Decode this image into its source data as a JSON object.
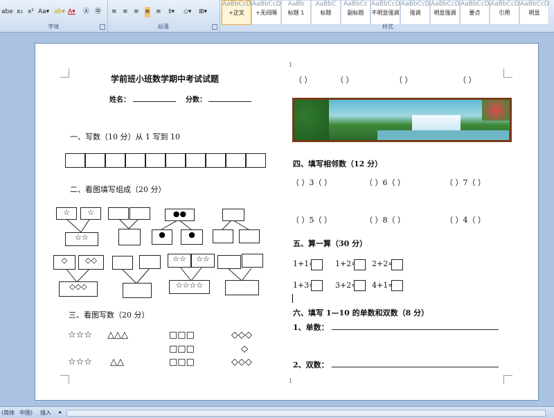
{
  "ribbon": {
    "font_group_label": "字体",
    "paragraph_group_label": "段落",
    "styles_group_label": "样式",
    "styles": [
      {
        "name": "+正文",
        "sample": "AaBbCcDd"
      },
      {
        "name": "+无间隔",
        "sample": "AaBbCcDd"
      },
      {
        "name": "标题 1",
        "sample": "AaBb"
      },
      {
        "name": "标题",
        "sample": "AaBbC"
      },
      {
        "name": "副标题",
        "sample": "AaBbCc"
      },
      {
        "name": "不明显强调",
        "sample": "AaBbCcDd"
      },
      {
        "name": "强调",
        "sample": "AaBbCcDd"
      },
      {
        "name": "明显强调",
        "sample": "AaBbCcDd"
      },
      {
        "name": "要点",
        "sample": "AaBbCcDd"
      },
      {
        "name": "引用",
        "sample": "AaBbCcDd"
      },
      {
        "name": "明显",
        "sample": "AaBbCcDd"
      }
    ]
  },
  "doc": {
    "title": "学前班小班数学期中考试试题",
    "name_label": "姓名：",
    "score_label": "分数：",
    "q1": "一、写数（10 分）从 1 写到 10",
    "q2": "二、看图填写组成（20 分）",
    "q3": "三、看图写数（20 分）",
    "q2_groups": {
      "g1_left": "☆",
      "g1_right": "☆",
      "g1_bottom": "☆☆",
      "g3_top": "●●",
      "g3_left": "●",
      "g3_right": "●",
      "g5_left": "◇",
      "g5_right": "◇◇",
      "g5_bottom": "◇◇◇",
      "g7_left": "☆☆",
      "g7_right": "☆☆",
      "g7_bottom": "☆☆☆☆"
    },
    "q3_rows": {
      "r1_stars": "☆☆☆",
      "r1_tri": "△△△",
      "r1_sq": "□□□",
      "r1_dia": "◇◇◇",
      "r2_sq": "□□□",
      "r2_dia": "◇",
      "r3_stars": "☆☆☆",
      "r3_tri": "△△",
      "r3_sq": "□□□",
      "r3_dia": "◇◇◇"
    },
    "page_number": "1",
    "right": {
      "top_paren": "（  ）",
      "q4": "四、填写相邻数（12 分）",
      "q4_row1": [
        "（    ）3（    ）",
        "（    ）6（    ）",
        "（    ）7（    ）"
      ],
      "q4_row2": [
        "（    ）5（    ）",
        "（    ）8（    ）",
        "（    ）4（    ）"
      ],
      "q5": "五、算一算（30 分）",
      "calc_row1": [
        "1+1=",
        "1+2=",
        "2+2="
      ],
      "calc_row2": [
        "1+3=",
        "3+2=",
        "4+1="
      ],
      "q6": "六、填写 1—10 的单数和双数（8 分）",
      "odd_label": "1、单数：",
      "even_label": "2、双数："
    }
  },
  "status": {
    "lang1": "(简体",
    "lang2": "中国)",
    "mode": "插入"
  }
}
